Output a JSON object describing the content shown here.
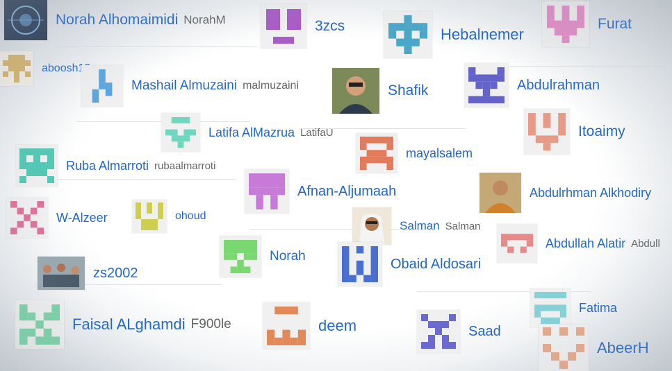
{
  "users": [
    {
      "name": "Norah Alhomaimidi",
      "login": "NorahM",
      "avatar": "photo",
      "color": "#2b3c55"
    },
    {
      "name": "3zcs",
      "login": "",
      "avatar": "identicon",
      "color": "#a85cc6"
    },
    {
      "name": "Hebalnemer",
      "login": "",
      "avatar": "identicon",
      "color": "#4aa7c8"
    },
    {
      "name": "Furat",
      "login": "",
      "avatar": "identicon",
      "color": "#e58ac7"
    },
    {
      "name": "aboosh13",
      "login": "",
      "avatar": "identicon",
      "color": "#d9b56a"
    },
    {
      "name": "Mashail Almuzaini",
      "login": "malmuzaini",
      "avatar": "identicon",
      "color": "#5ba6e0"
    },
    {
      "name": "Shafik",
      "login": "",
      "avatar": "photo",
      "color": "#3a4a3a"
    },
    {
      "name": "Abdulrahman",
      "login": "",
      "avatar": "identicon",
      "color": "#6463c9"
    },
    {
      "name": "Latifa AlMazrua",
      "login": "LatifaU",
      "avatar": "identicon",
      "color": "#6fd6c0"
    },
    {
      "name": "Itoaimy",
      "login": "",
      "avatar": "identicon",
      "color": "#e79a86"
    },
    {
      "name": "mayalsalem",
      "login": "",
      "avatar": "identicon",
      "color": "#e17b5c"
    },
    {
      "name": "Ruba Almarroti",
      "login": "rubaalmarroti",
      "avatar": "identicon",
      "color": "#52c9b5"
    },
    {
      "name": "Afnan-Aljumaah",
      "login": "",
      "avatar": "identicon",
      "color": "#c87ad8"
    },
    {
      "name": "Abdulrhman Alkhodiry",
      "login": "",
      "avatar": "photo",
      "color": "#5a3a1a"
    },
    {
      "name": "W-Alzeer",
      "login": "",
      "avatar": "identicon",
      "color": "#e0709a"
    },
    {
      "name": "ohoud",
      "login": "",
      "avatar": "identicon",
      "color": "#cfcf4f"
    },
    {
      "name": "Salman",
      "login": "Salman",
      "avatar": "photo",
      "color": "#b08060"
    },
    {
      "name": "Abdullah Alatir",
      "login": "Abdull",
      "avatar": "identicon",
      "color": "#e68a8a"
    },
    {
      "name": "zs2002",
      "login": "",
      "avatar": "photo",
      "color": "#6a7a8a"
    },
    {
      "name": "Norah",
      "login": "",
      "avatar": "identicon",
      "color": "#7bd870"
    },
    {
      "name": "Obaid Aldosari",
      "login": "",
      "avatar": "identicon",
      "color": "#4a6fd0"
    },
    {
      "name": "Fatima",
      "login": "",
      "avatar": "identicon",
      "color": "#86d0d8"
    },
    {
      "name": "Faisal ALghamdi",
      "login": "F900le",
      "avatar": "identicon",
      "color": "#7ad3a8"
    },
    {
      "name": "deem",
      "login": "",
      "avatar": "identicon",
      "color": "#e08a5a"
    },
    {
      "name": "Saad",
      "login": "",
      "avatar": "identicon",
      "color": "#6a6ad0"
    },
    {
      "name": "AbeerH",
      "login": "",
      "avatar": "identicon",
      "color": "#e8a98c"
    }
  ]
}
